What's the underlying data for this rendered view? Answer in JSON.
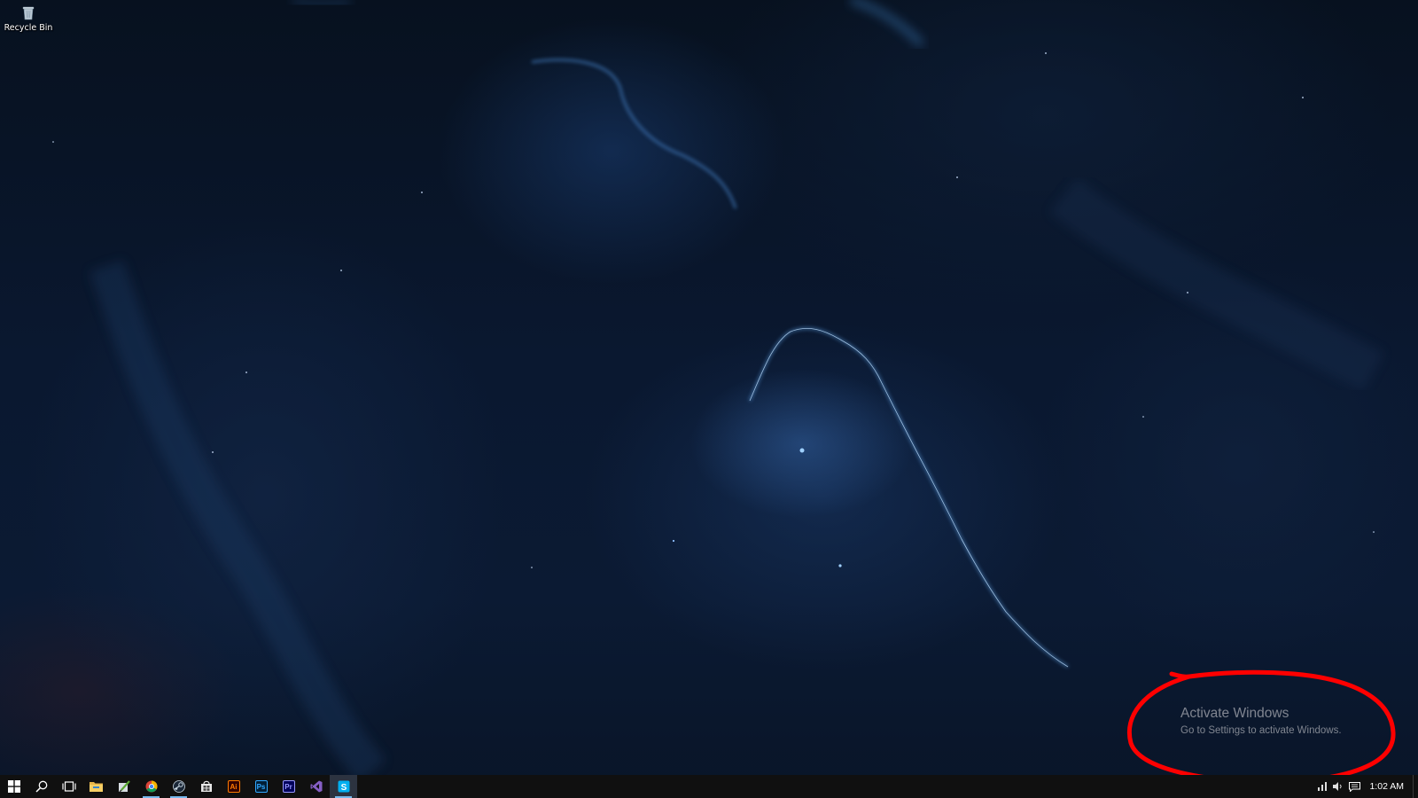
{
  "desktop": {
    "icons": [
      {
        "label": "Recycle Bin",
        "icon": "recycle-bin-icon"
      }
    ]
  },
  "watermark": {
    "title": "Activate Windows",
    "subtitle": "Go to Settings to activate Windows."
  },
  "annotation": {
    "shape": "hand-drawn ellipse",
    "color": "#ff0000"
  },
  "taskbar": {
    "apps": [
      {
        "name": "Start",
        "icon": "windows-logo-icon"
      },
      {
        "name": "Search",
        "icon": "search-icon"
      },
      {
        "name": "Task View",
        "icon": "task-view-icon"
      },
      {
        "name": "File Explorer",
        "icon": "folder-icon"
      },
      {
        "name": "Pen app",
        "icon": "pen-icon"
      },
      {
        "name": "Google Chrome",
        "icon": "chrome-icon"
      },
      {
        "name": "Steam",
        "icon": "steam-icon"
      },
      {
        "name": "Store",
        "icon": "store-icon"
      },
      {
        "name": "Ai",
        "icon": "illustrator-icon"
      },
      {
        "name": "Ps",
        "icon": "photoshop-icon"
      },
      {
        "name": "Pr",
        "icon": "premiere-icon"
      },
      {
        "name": "Visual Studio",
        "icon": "visual-studio-icon"
      },
      {
        "name": "Skype",
        "icon": "skype-icon"
      }
    ],
    "clock": "1:02 AM",
    "colors": {
      "taskbar_bg": "#101010",
      "running_indicator": "#76b9ed",
      "illustrator": "#ff7c00",
      "photoshop": "#31a8ff",
      "premiere": "#9999ff",
      "visual_studio": "#865fc5",
      "skype": "#00aff0"
    }
  }
}
